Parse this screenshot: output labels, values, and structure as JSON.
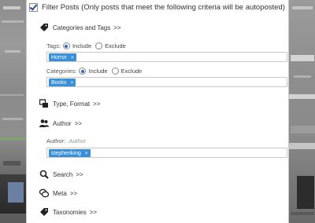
{
  "header": {
    "title": "Filter Posts (Only posts that meet the following criteria will be autoposted)"
  },
  "sections": {
    "categories_tags": {
      "label": "Categories and Tags",
      "chevron": ">>"
    },
    "type_format": {
      "label": "Type, Format",
      "chevron": ">>"
    },
    "author": {
      "label": "Author",
      "chevron": ">>"
    },
    "search": {
      "label": "Search",
      "chevron": ">>"
    },
    "meta": {
      "label": "Meta",
      "chevron": ">>"
    },
    "taxonomies": {
      "label": "Taxonomies",
      "chevron": ">>"
    }
  },
  "tags_filter": {
    "label": "Tags:",
    "include_label": "Include",
    "exclude_label": "Exclude",
    "mode": "include",
    "chips": [
      "Horror"
    ],
    "chip_remove": "×"
  },
  "categories_filter": {
    "label": "Categories:",
    "include_label": "Include",
    "exclude_label": "Exclude",
    "mode": "include",
    "chips": [
      "Books"
    ],
    "chip_remove": "×"
  },
  "author_filter": {
    "label": "Author:",
    "placeholder": "Author",
    "chips": [
      "stephenking"
    ],
    "chip_remove": "×"
  },
  "colors": {
    "chip": "#3a8fd6",
    "radio_on": "#2e63c4"
  }
}
